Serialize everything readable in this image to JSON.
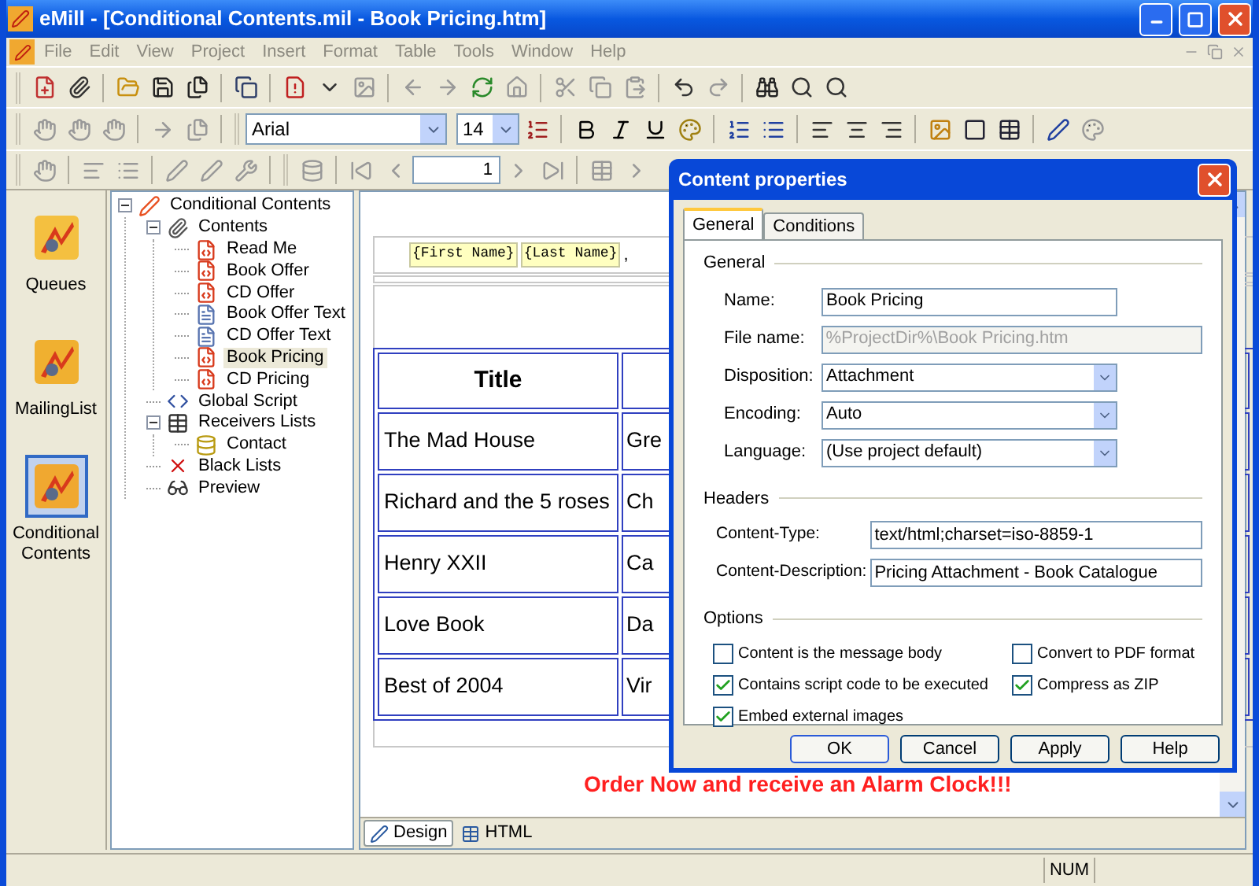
{
  "window": {
    "title": "eMill - [Conditional Contents.mil - Book Pricing.htm]"
  },
  "menu": [
    "File",
    "Edit",
    "View",
    "Project",
    "Insert",
    "Format",
    "Table",
    "Tools",
    "Window",
    "Help"
  ],
  "format_toolbar": {
    "font": "Arial",
    "size": "14"
  },
  "navigation_toolbar": {
    "page": "1"
  },
  "sidebar": {
    "items": [
      {
        "label": "Queues",
        "kind": "queues",
        "selected": false
      },
      {
        "label": "MailingList",
        "kind": "mailing",
        "selected": false
      },
      {
        "label": "Conditional Contents",
        "kind": "conditional",
        "selected": true
      }
    ]
  },
  "tree": [
    {
      "label": "Conditional Contents",
      "kind": "project",
      "expanded": true,
      "selected": false,
      "children": [
        {
          "label": "Contents",
          "kind": "clip",
          "expanded": true,
          "selected": false,
          "children": [
            {
              "label": "Read Me",
              "kind": "html",
              "selected": false
            },
            {
              "label": "Book Offer",
              "kind": "html",
              "selected": false
            },
            {
              "label": "CD Offer",
              "kind": "html",
              "selected": false
            },
            {
              "label": "Book Offer Text",
              "kind": "text",
              "selected": false
            },
            {
              "label": "CD Offer Text",
              "kind": "text",
              "selected": false
            },
            {
              "label": "Book Pricing",
              "kind": "html",
              "selected": true
            },
            {
              "label": "CD Pricing",
              "kind": "html",
              "selected": false
            }
          ]
        },
        {
          "label": "Global Script",
          "kind": "script",
          "selected": false
        },
        {
          "label": "Receivers Lists",
          "kind": "table",
          "expanded": true,
          "selected": false,
          "children": [
            {
              "label": "Contact",
              "kind": "database",
              "selected": false
            }
          ]
        },
        {
          "label": "Black Lists",
          "kind": "blacklist",
          "selected": false
        },
        {
          "label": "Preview",
          "kind": "preview",
          "selected": false
        }
      ]
    }
  ],
  "document": {
    "merge_fields": [
      "{First Name}",
      "{Last Name}"
    ],
    "separator": ",",
    "table": {
      "header": "Title",
      "rows": [
        [
          "The Mad House",
          "Gre"
        ],
        [
          "Richard and the 5 roses",
          "Ch"
        ],
        [
          "Henry XXII",
          "Ca"
        ],
        [
          "Love Book",
          "Da"
        ],
        [
          "Best of 2004",
          "Vir"
        ]
      ]
    },
    "promo": "Order Now and receive an Alarm Clock!!!"
  },
  "view_tabs": [
    {
      "label": "Design",
      "kind": "design",
      "selected": true
    },
    {
      "label": "HTML",
      "kind": "html",
      "selected": false
    }
  ],
  "status_bar": {
    "indicator": "NUM"
  },
  "dialog": {
    "title": "Content properties",
    "tabs": [
      {
        "label": "General",
        "selected": true
      },
      {
        "label": "Conditions",
        "selected": false
      }
    ],
    "general": {
      "heading": "General",
      "fields": [
        {
          "label": "Name:",
          "value": "Book Pricing",
          "kind": "text"
        },
        {
          "label": "File name:",
          "value": "%ProjectDir%\\Book Pricing.htm",
          "kind": "readonly"
        },
        {
          "label": "Disposition:",
          "value": "Attachment",
          "kind": "select"
        },
        {
          "label": "Encoding:",
          "value": "Auto",
          "kind": "select"
        },
        {
          "label": "Language:",
          "value": "(Use project default)",
          "kind": "select"
        }
      ]
    },
    "headers": {
      "heading": "Headers",
      "fields": [
        {
          "label": "Content-Type:",
          "value": "text/html;charset=iso-8859-1"
        },
        {
          "label": "Content-Description:",
          "value": "Pricing Attachment - Book Catalogue"
        }
      ]
    },
    "options": {
      "heading": "Options",
      "checkboxes": [
        {
          "label": "Content is the message body",
          "checked": false
        },
        {
          "label": "Convert to PDF format",
          "checked": false
        },
        {
          "label": "Contains script code to be executed",
          "checked": true
        },
        {
          "label": "Compress as ZIP",
          "checked": true
        },
        {
          "label": "Embed external images",
          "checked": true
        }
      ]
    },
    "buttons": [
      "OK",
      "Cancel",
      "Apply",
      "Help"
    ]
  }
}
